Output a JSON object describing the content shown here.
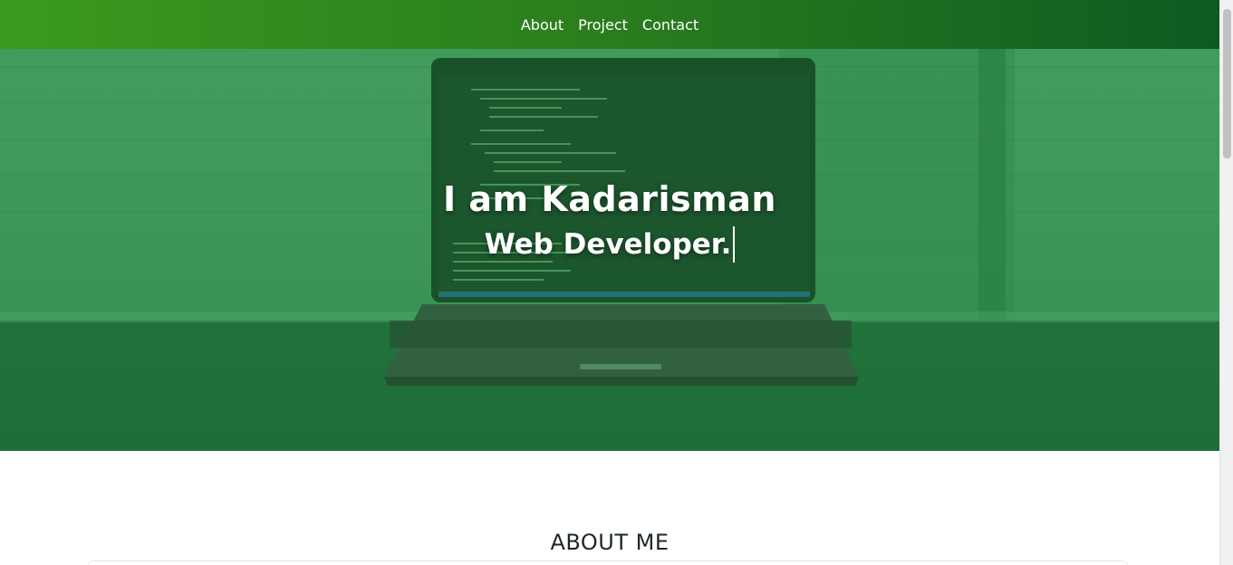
{
  "nav": {
    "items": [
      {
        "label": "About"
      },
      {
        "label": "Project"
      },
      {
        "label": "Contact"
      }
    ]
  },
  "hero": {
    "name": "I am Kadarisman",
    "role": "Web Developer."
  },
  "about": {
    "title": "ABOUT ME"
  },
  "colors": {
    "nav_gradient_start": "#3a9a1e",
    "nav_gradient_end": "#0f5a22",
    "hero_tint": "#3f8f58"
  }
}
